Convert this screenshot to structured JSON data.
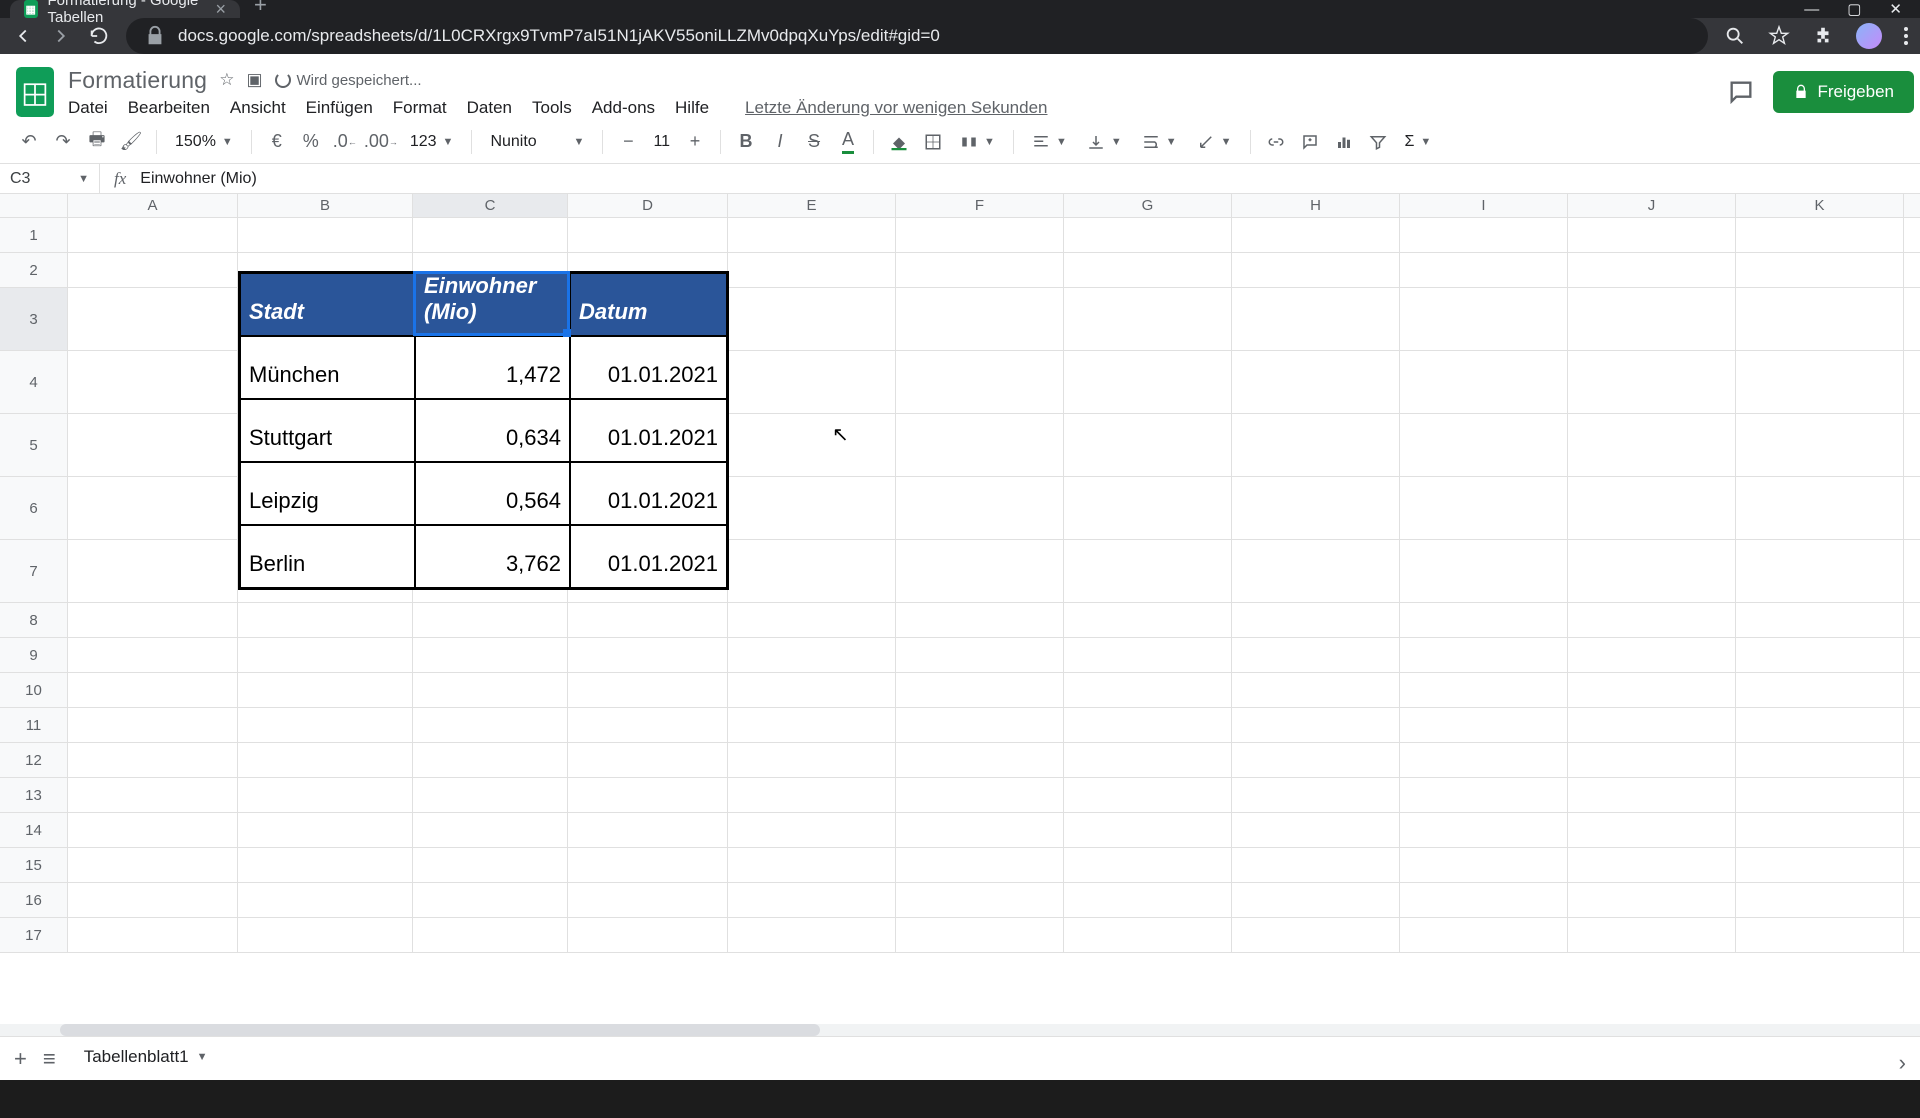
{
  "browser": {
    "tab_title": "Formatierung - Google Tabellen",
    "url": "docs.google.com/spreadsheets/d/1L0CRXrgx9TvmP7aI51N1jAKV55oniLLZMv0dpqXuYps/edit#gid=0"
  },
  "doc": {
    "title": "Formatierung",
    "saving_status": "Wird gespeichert...",
    "last_edit": "Letzte Änderung vor wenigen Sekunden"
  },
  "menus": {
    "file": "Datei",
    "edit": "Bearbeiten",
    "view": "Ansicht",
    "insert": "Einfügen",
    "format": "Format",
    "data": "Daten",
    "tools": "Tools",
    "addons": "Add-ons",
    "help": "Hilfe"
  },
  "toolbar": {
    "zoom": "150%",
    "currency": "€",
    "percent": "%",
    "dec_less": ".0",
    "dec_more": ".00",
    "numfmt": "123",
    "font": "Nunito",
    "font_size": "11",
    "bold": "B",
    "italic": "I",
    "strike": "S",
    "textcolor": "A",
    "sigma": "Σ"
  },
  "fx": {
    "cell_ref": "C3",
    "formula": "Einwohner (Mio)",
    "fx_label": "fx"
  },
  "columns": [
    "A",
    "B",
    "C",
    "D",
    "E",
    "F",
    "G",
    "H",
    "I",
    "J",
    "K"
  ],
  "rows": [
    "1",
    "2",
    "3",
    "4",
    "5",
    "6",
    "7",
    "8",
    "9",
    "10",
    "11",
    "12",
    "13",
    "14",
    "15",
    "16",
    "17"
  ],
  "table": {
    "headers": {
      "city": "Stadt",
      "pop": "Einwohner (Mio)",
      "date": "Datum"
    },
    "rows": [
      {
        "city": "München",
        "pop": "1,472",
        "date": "01.01.2021"
      },
      {
        "city": "Stuttgart",
        "pop": "0,634",
        "date": "01.01.2021"
      },
      {
        "city": "Leipzig",
        "pop": "0,564",
        "date": "01.01.2021"
      },
      {
        "city": "Berlin",
        "pop": "3,762",
        "date": "01.01.2021"
      }
    ]
  },
  "sheet_tab": "Tabellenblatt1",
  "share_label": "Freigeben",
  "colors": {
    "header_bg": "#2a5599",
    "accent": "#1a73e8",
    "share": "#1a8e3d"
  }
}
